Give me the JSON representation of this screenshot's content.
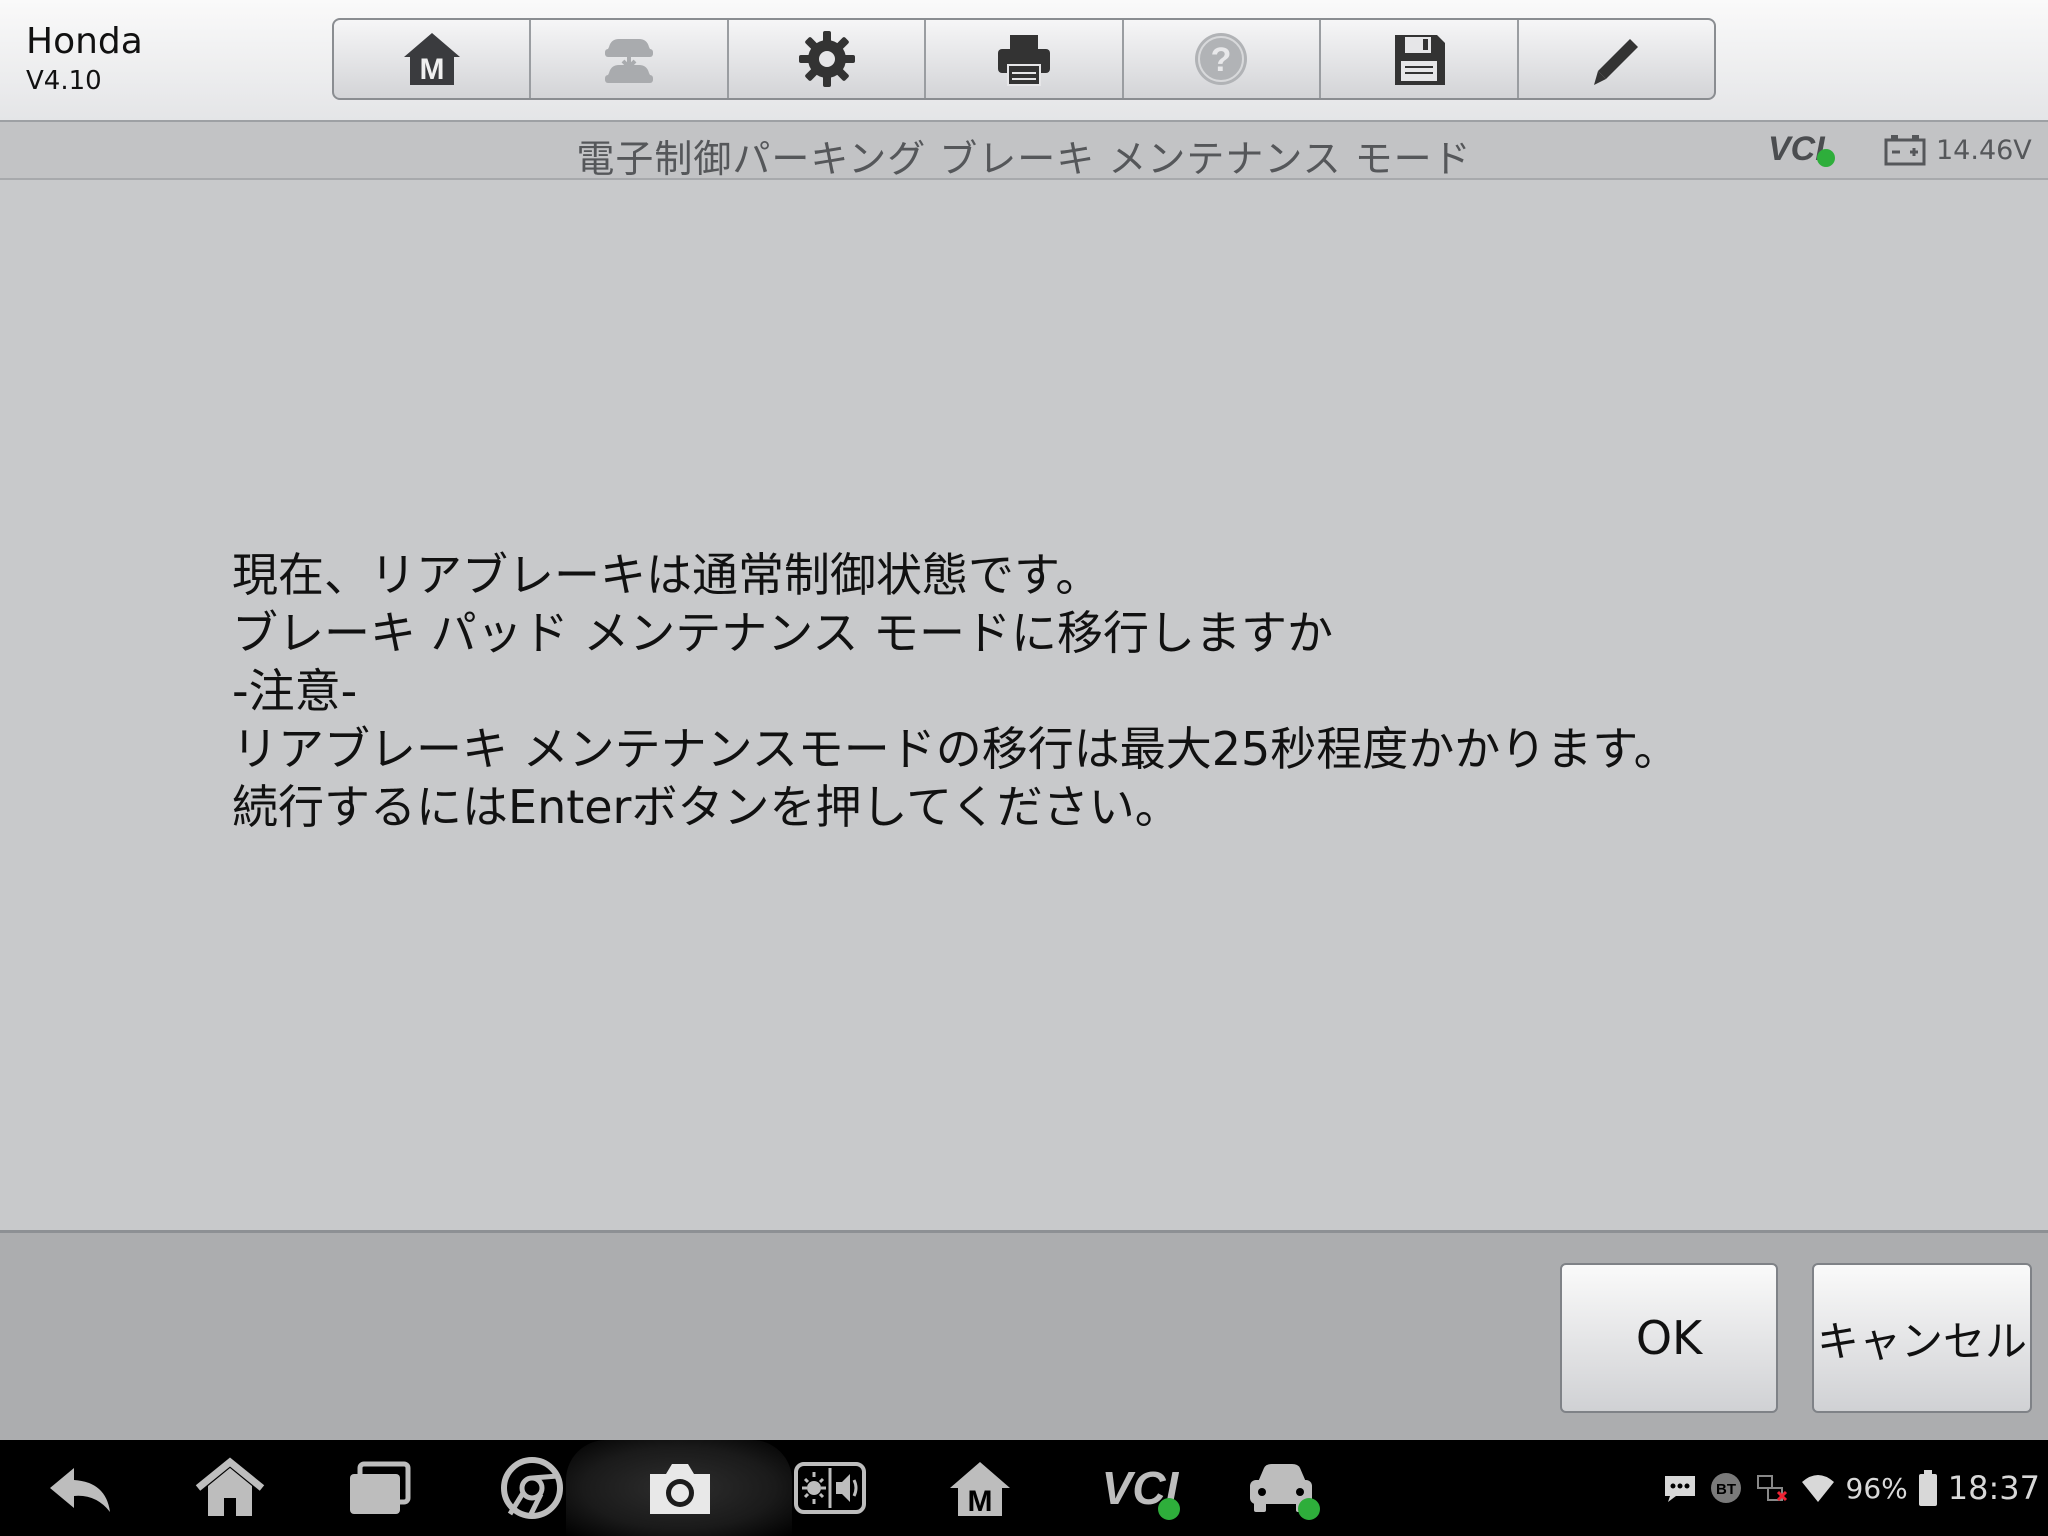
{
  "header": {
    "make": "Honda",
    "version": "V4.10",
    "toolbar": [
      {
        "name": "home-button",
        "icon": "m-home-icon"
      },
      {
        "name": "vehicle-swap-button",
        "icon": "car-swap-icon"
      },
      {
        "name": "settings-button",
        "icon": "gear-icon"
      },
      {
        "name": "print-button",
        "icon": "printer-icon"
      },
      {
        "name": "help-button",
        "icon": "help-icon"
      },
      {
        "name": "save-button",
        "icon": "floppy-icon"
      },
      {
        "name": "edit-button",
        "icon": "pencil-icon"
      }
    ]
  },
  "titlebar": {
    "title": "電子制御パーキング ブレーキ メンテナンス モード",
    "vcl_label": "VCI",
    "voltage": "14.46V"
  },
  "message": {
    "lines": [
      "現在、リアブレーキは通常制御状態です。",
      "ブレーキ パッド メンテナンス モードに移行しますか",
      "-注意-",
      "リアブレーキ メンテナンスモードの移行は最大25秒程度かかります。",
      "続行するにはEnterボタンを押してください。"
    ]
  },
  "actions": {
    "ok": "OK",
    "cancel": "キャンセル"
  },
  "system_bar": {
    "vcl_label": "VCI",
    "bt_label": "BT",
    "battery": "96%",
    "clock": "18:37"
  },
  "colors": {
    "background": "#c8c9cb",
    "ok_green": "#2eae3b"
  }
}
